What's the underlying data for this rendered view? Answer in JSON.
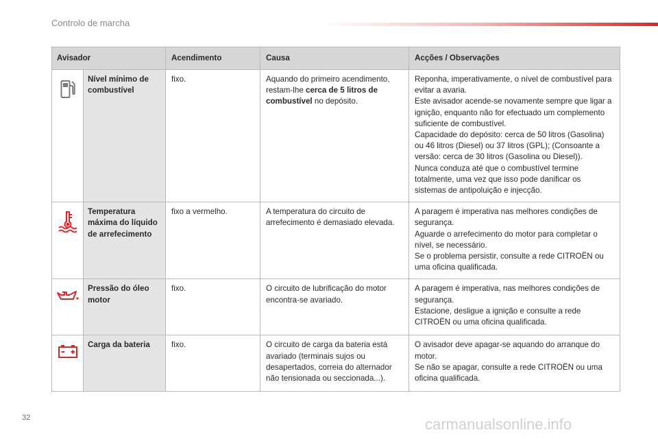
{
  "header": {
    "title": "Controlo de marcha"
  },
  "page_number": "32",
  "watermark": "carmanualsonline.info",
  "table": {
    "columns": [
      "Avisador",
      "Acendimento",
      "Causa",
      "Acções / Observações"
    ],
    "rows": [
      {
        "icon": "fuel-pump-icon",
        "name": "Nível mínimo de combustível",
        "lighting": "fixo.",
        "cause": [
          {
            "t": "Aquando do primeiro acendimento, restam-lhe ",
            "b": false
          },
          {
            "t": "cerca de 5 litros de combustível",
            "b": true
          },
          {
            "t": " no depósito.",
            "b": false
          }
        ],
        "actions": "Reponha, imperativamente, o nível de combustível para evitar a avaria.\nEste avisador acende-se novamente sempre que ligar a ignição, enquanto não for efectuado um complemento suficiente de combustível.\nCapacidade do depósito: cerca de 50 litros (Gasolina) ou 46 litros (Diesel) ou 37 litros (GPL); (Consoante a versão: cerca de 30 litros (Gasolina ou Diesel)).\nNunca conduza até que o combustível termine totalmente, uma vez que isso pode danificar os sistemas de antipoluição e injecção."
      },
      {
        "icon": "coolant-temperature-icon",
        "name": "Temperatura máxima do líquido de arrefecimento",
        "lighting": "fixo a vermelho.",
        "cause": [
          {
            "t": "A temperatura do circuito de arrefecimento é demasiado elevada.",
            "b": false
          }
        ],
        "actions": "A paragem é imperativa nas melhores condições de segurança.\nAguarde o arrefecimento do motor para completar o nível, se necessário.\nSe o problema persistir, consulte a rede CITROËN ou uma oficina qualificada."
      },
      {
        "icon": "oil-can-icon",
        "name": "Pressão do óleo motor",
        "lighting": "fixo.",
        "cause": [
          {
            "t": "O circuito de lubrificação do motor encontra-se avariado.",
            "b": false
          }
        ],
        "actions": "A paragem é imperativa, nas melhores condições de segurança.\nEstacione, desligue a ignição e consulte a rede CITROËN ou uma oficina qualificada."
      },
      {
        "icon": "battery-icon",
        "name": "Carga da bateria",
        "lighting": "fixo.",
        "cause": [
          {
            "t": "O circuito de carga da bateria está avariado (terminais sujos ou desapertados, correia do alternador não tensionada ou seccionada...).",
            "b": false
          }
        ],
        "actions": "O avisador deve apagar-se aquando do arranque do motor.\nSe não se apagar, consulte a rede CITROËN ou uma oficina qualificada."
      }
    ]
  },
  "colors": {
    "icon_red": "#e2222a",
    "icon_gray": "#7a7a7a",
    "header_row_bg": "#d6d6d6",
    "name_cell_bg": "#e4e4e4",
    "accent_bar": "#e2222a"
  }
}
